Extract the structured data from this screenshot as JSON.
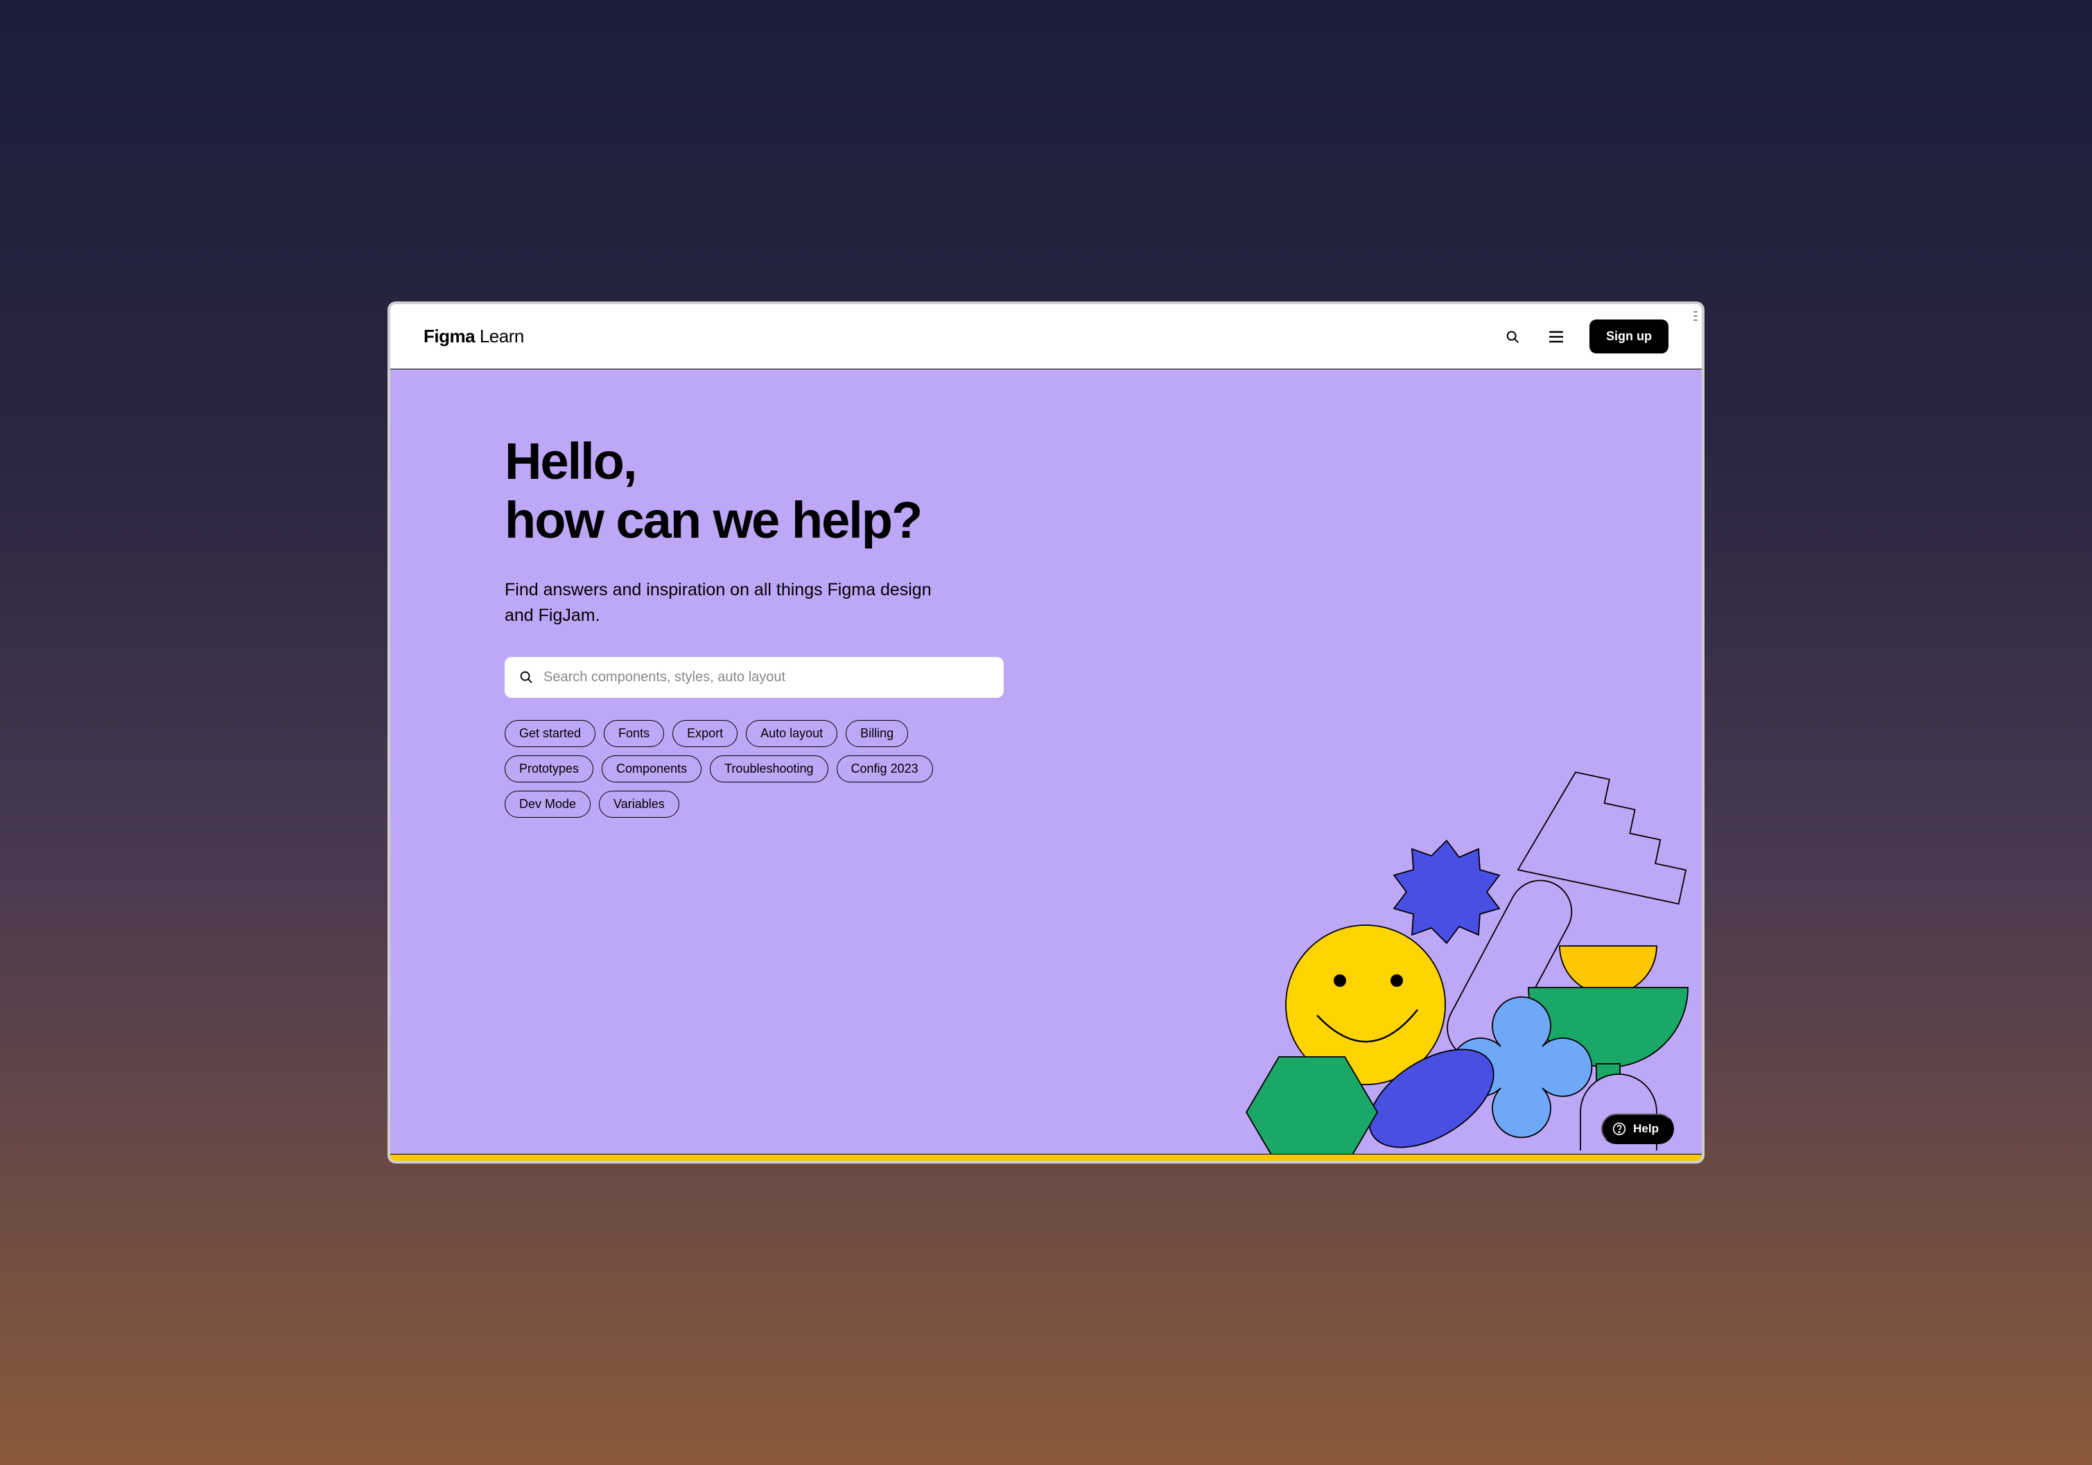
{
  "header": {
    "logo_bold": "Figma",
    "logo_light": "Learn",
    "signup_label": "Sign up"
  },
  "hero": {
    "heading_line1": "Hello,",
    "heading_line2": "how can we help?",
    "subtitle": "Find answers and inspiration on all things Figma design and FigJam.",
    "search_placeholder": "Search components, styles, auto layout"
  },
  "chips": [
    "Get started",
    "Fonts",
    "Export",
    "Auto layout",
    "Billing",
    "Prototypes",
    "Components",
    "Troubleshooting",
    "Config 2023",
    "Dev Mode",
    "Variables"
  ],
  "help_widget": {
    "label": "Help"
  }
}
